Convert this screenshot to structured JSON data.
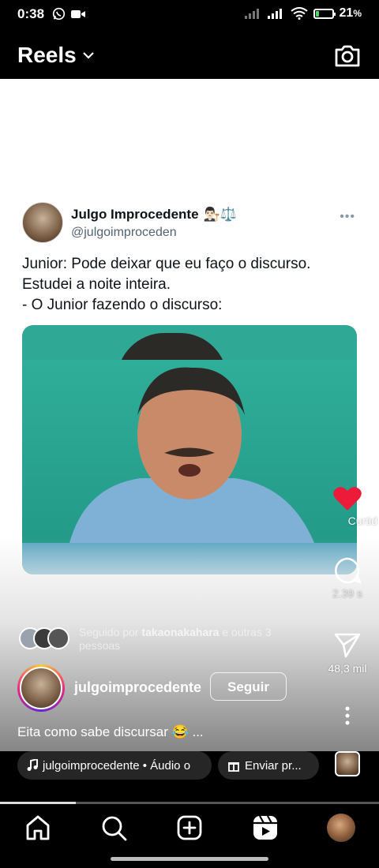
{
  "status_bar": {
    "time": "0:38",
    "battery": "21",
    "battery_unit": "%",
    "battery_level": 0.21
  },
  "header": {
    "title": "Reels"
  },
  "tweet": {
    "name": "Julgo Improcedente",
    "emoji": "👨🏻‍⚖️⚖️",
    "handle": "@julgoimproceden",
    "text_lines": [
      "Junior: Pode deixar que eu faço o discurso.",
      "Estudei a noite inteira.",
      "- O Junior fazendo o discurso:"
    ]
  },
  "actions": {
    "like_label": "Curtid",
    "comments_count": "2.39 s",
    "shares_count": "48,3 mil"
  },
  "followed": {
    "prefix": "Seguido por ",
    "user": "takaonakahara",
    "suffix": " e outras 3 pessoas"
  },
  "owner": {
    "username": "julgoimprocedente",
    "follow_label": "Seguir"
  },
  "caption": "Eita como sabe discursar 😂 ...",
  "audio": {
    "label": "julgoimprocedente • Áudio o",
    "gift_label": "Enviar pr..."
  },
  "progress": 0.2,
  "colors": {
    "like": "#ed1b3a",
    "media_bg": "#2fa895"
  }
}
